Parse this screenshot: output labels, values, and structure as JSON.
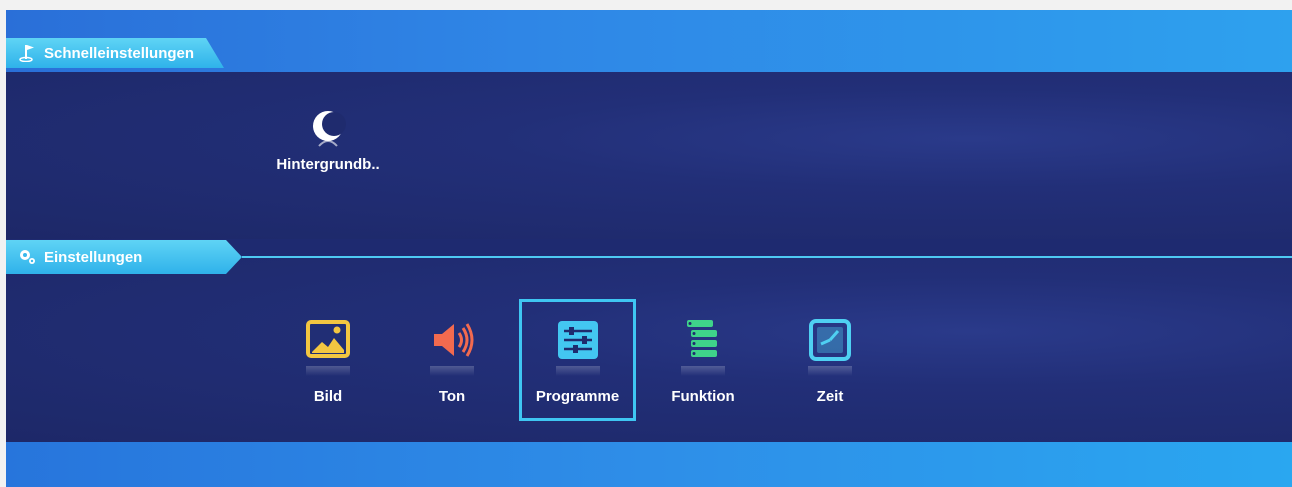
{
  "sections": {
    "quick": {
      "title": "Schnelleinstellungen",
      "icon": "flag-icon",
      "items": [
        {
          "label": "Hintergrundb..",
          "icon": "moon-icon"
        }
      ]
    },
    "settings": {
      "title": "Einstellungen",
      "icon": "gears-icon",
      "items": [
        {
          "label": "Bild",
          "icon": "picture-icon"
        },
        {
          "label": "Ton",
          "icon": "speaker-icon"
        },
        {
          "label": "Programme",
          "icon": "sliders-icon",
          "selected": true
        },
        {
          "label": "Funktion",
          "icon": "list-stack-icon"
        },
        {
          "label": "Zeit",
          "icon": "clock-icon"
        }
      ]
    }
  },
  "colors": {
    "background": "#1e2a70",
    "accent": "#3fc6f2",
    "picture_icon": "#f3c641",
    "speaker_icon": "#f26a4f",
    "sliders_icon": "#43c7f1",
    "list_icon": "#3fd38a",
    "clock_icon": "#4fd0f2"
  }
}
